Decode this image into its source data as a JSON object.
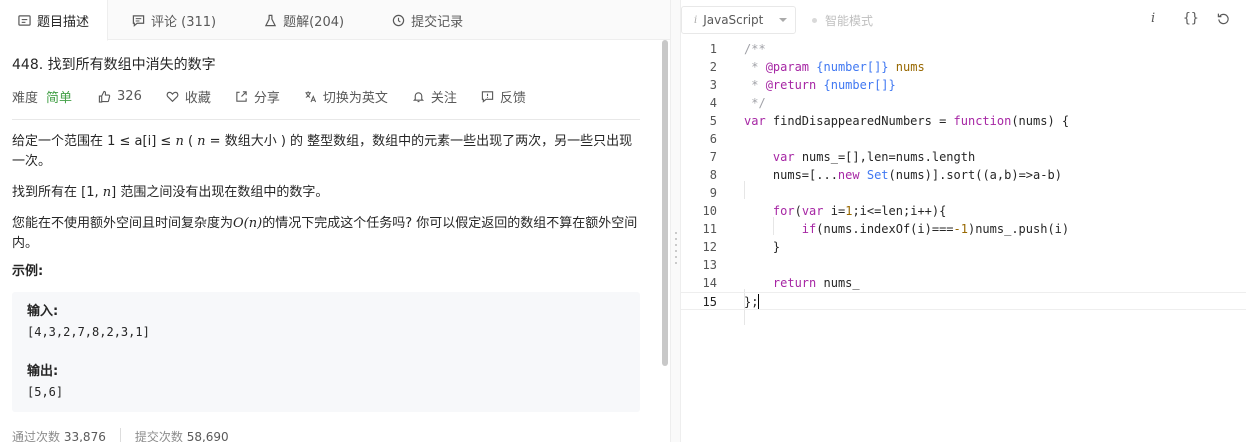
{
  "tabs": [
    {
      "label": "题目描述",
      "icon": "description-icon"
    },
    {
      "label": "评论 (311)",
      "icon": "comment-icon"
    },
    {
      "label": "题解(204)",
      "icon": "solution-flask-icon"
    },
    {
      "label": "提交记录",
      "icon": "history-icon"
    }
  ],
  "problem": {
    "title": "448. 找到所有数组中消失的数字",
    "difficulty_label": "难度",
    "difficulty": "简单",
    "likes": "326",
    "favorite": "收藏",
    "share": "分享",
    "translate": "切换为英文",
    "follow": "关注",
    "feedback": "反馈"
  },
  "description": {
    "p1_a": "给定一个范围在  1 ≤ a[i] ≤ ",
    "p1_n": "n",
    "p1_b": " ( ",
    "p1_n2": "n",
    "p1_c": " = 数组大小 ) 的 整型数组，数组中的元素一些出现了两次，另一些只出现一次。",
    "p2_a": "找到所有在 [1, ",
    "p2_n": "n",
    "p2_b": "] 范围之间没有出现在数组中的数字。",
    "p3_a": "您能在不使用额外空间且时间复杂度为",
    "p3_o": "O(n)",
    "p3_b": "的情况下完成这个任务吗? 你可以假定返回的数组不算在额外空间内。",
    "example_title": "示例:"
  },
  "example": {
    "input_label": "输入:",
    "input_value": "[4,3,2,7,8,2,3,1]",
    "output_label": "输出:",
    "output_value": "[5,6]"
  },
  "stats": {
    "passed_label": "通过次数",
    "passed": "33,876",
    "submitted_label": "提交次数",
    "submitted": "58,690"
  },
  "editor": {
    "language": "JavaScript",
    "smart_mode": "智能模式",
    "toolbar_icons": [
      "info-icon",
      "braces-icon",
      "reset-icon"
    ],
    "line_numbers": [
      "1",
      "2",
      "3",
      "4",
      "5",
      "6",
      "7",
      "8",
      "9",
      "10",
      "11",
      "12",
      "13",
      "14",
      "15"
    ],
    "current_line": 15
  }
}
